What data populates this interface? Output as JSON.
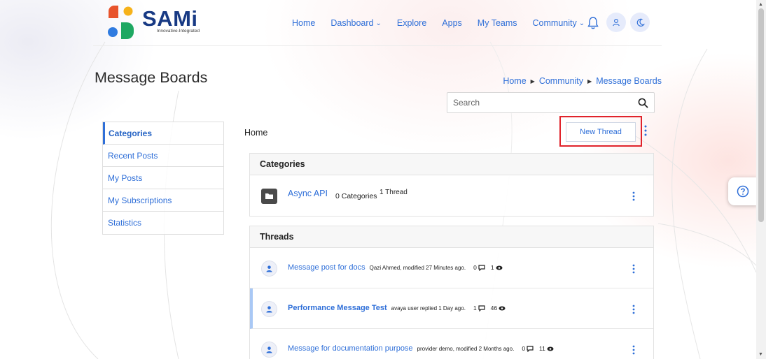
{
  "brand": {
    "name": "SAMi",
    "tagline": "Innovative-Integrated"
  },
  "nav": {
    "items": [
      {
        "label": "Home"
      },
      {
        "label": "Dashboard",
        "has_dropdown": true
      },
      {
        "label": "Explore"
      },
      {
        "label": "Apps"
      },
      {
        "label": "My Teams"
      },
      {
        "label": "Community",
        "has_dropdown": true
      }
    ],
    "icons": [
      "bell-icon",
      "user-icon",
      "moon-icon"
    ]
  },
  "page": {
    "title": "Message Boards",
    "breadcrumb": [
      "Home",
      "Community",
      "Message Boards"
    ]
  },
  "search": {
    "placeholder": "Search",
    "value": ""
  },
  "sidebar": {
    "items": [
      {
        "label": "Categories",
        "active": true
      },
      {
        "label": "Recent Posts"
      },
      {
        "label": "My Posts"
      },
      {
        "label": "My Subscriptions"
      },
      {
        "label": "Statistics"
      }
    ]
  },
  "main": {
    "current": "Home",
    "new_thread_label": "New Thread",
    "categories": {
      "heading": "Categories",
      "items": [
        {
          "name": "Async API",
          "count_label": "0 Categories",
          "threads_label": "1 Thread"
        }
      ]
    },
    "threads": {
      "heading": "Threads",
      "items": [
        {
          "title": "Message post for docs",
          "meta": "Qazi Ahmed, modified 27 Minutes ago.",
          "replies": "0",
          "views": "1",
          "bold": false,
          "highlight": false
        },
        {
          "title": "Performance Message Test",
          "meta": "avaya user replied 1 Day ago.",
          "replies": "1",
          "views": "46",
          "bold": true,
          "highlight": true
        },
        {
          "title": "Message for documentation purpose",
          "meta": "provider demo, modified 2 Months ago.",
          "replies": "0",
          "views": "11",
          "bold": false,
          "highlight": false
        }
      ]
    }
  },
  "colors": {
    "accent": "#2f6fd8",
    "brand_navy": "#183a84",
    "highlight_border": "#e0232b"
  }
}
